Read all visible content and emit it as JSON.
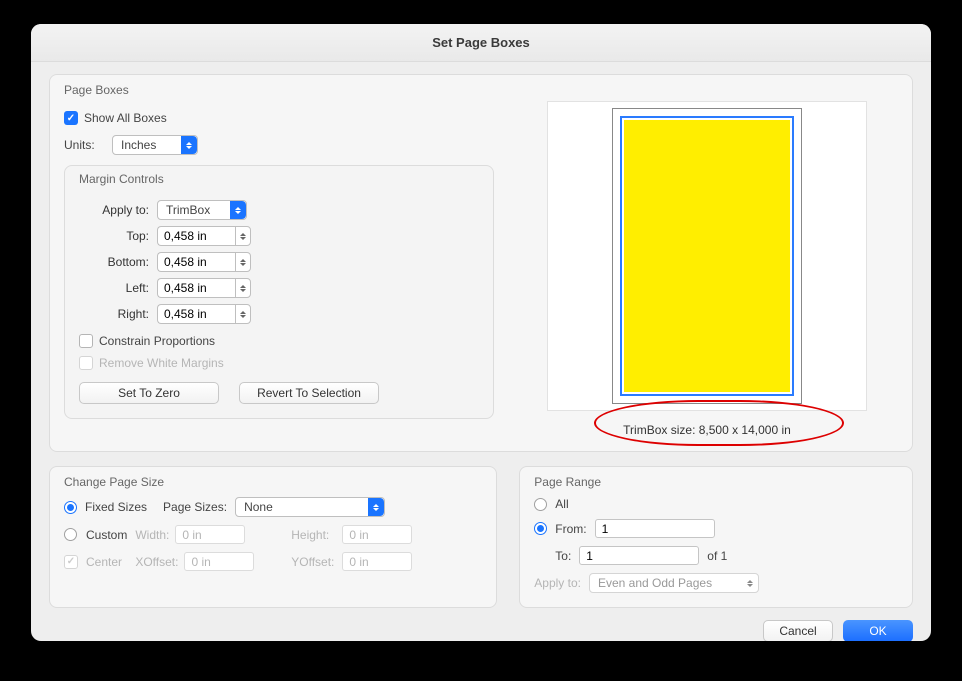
{
  "title": "Set Page Boxes",
  "page_boxes": {
    "section_label": "Page Boxes",
    "show_all_label": "Show All Boxes",
    "show_all_checked": true,
    "units_label": "Units:",
    "units_value": "Inches",
    "margin_controls": {
      "section_label": "Margin Controls",
      "apply_to_label": "Apply to:",
      "apply_to_value": "TrimBox",
      "top_label": "Top:",
      "top_value": "0,458 in",
      "bottom_label": "Bottom:",
      "bottom_value": "0,458 in",
      "left_label": "Left:",
      "left_value": "0,458 in",
      "right_label": "Right:",
      "right_value": "0,458 in",
      "constrain_label": "Constrain Proportions",
      "remove_wm_label": "Remove White Margins",
      "set_zero_label": "Set To Zero",
      "revert_label": "Revert To Selection"
    },
    "preview_size_text": "TrimBox size: 8,500 x 14,000 in"
  },
  "change_page_size": {
    "section_label": "Change Page Size",
    "fixed_sizes_label": "Fixed Sizes",
    "page_sizes_label": "Page Sizes:",
    "page_sizes_value": "None",
    "custom_label": "Custom",
    "width_label": "Width:",
    "width_value": "0 in",
    "height_label": "Height:",
    "height_value": "0 in",
    "center_label": "Center",
    "xoffset_label": "XOffset:",
    "xoffset_value": "0 in",
    "yoffset_label": "YOffset:",
    "yoffset_value": "0 in"
  },
  "page_range": {
    "section_label": "Page Range",
    "all_label": "All",
    "from_label": "From:",
    "from_value": "1",
    "to_label": "To:",
    "to_value": "1",
    "of_text": "of 1",
    "apply_to_label": "Apply to:",
    "apply_to_value": "Even and Odd Pages"
  },
  "footer": {
    "cancel": "Cancel",
    "ok": "OK"
  }
}
